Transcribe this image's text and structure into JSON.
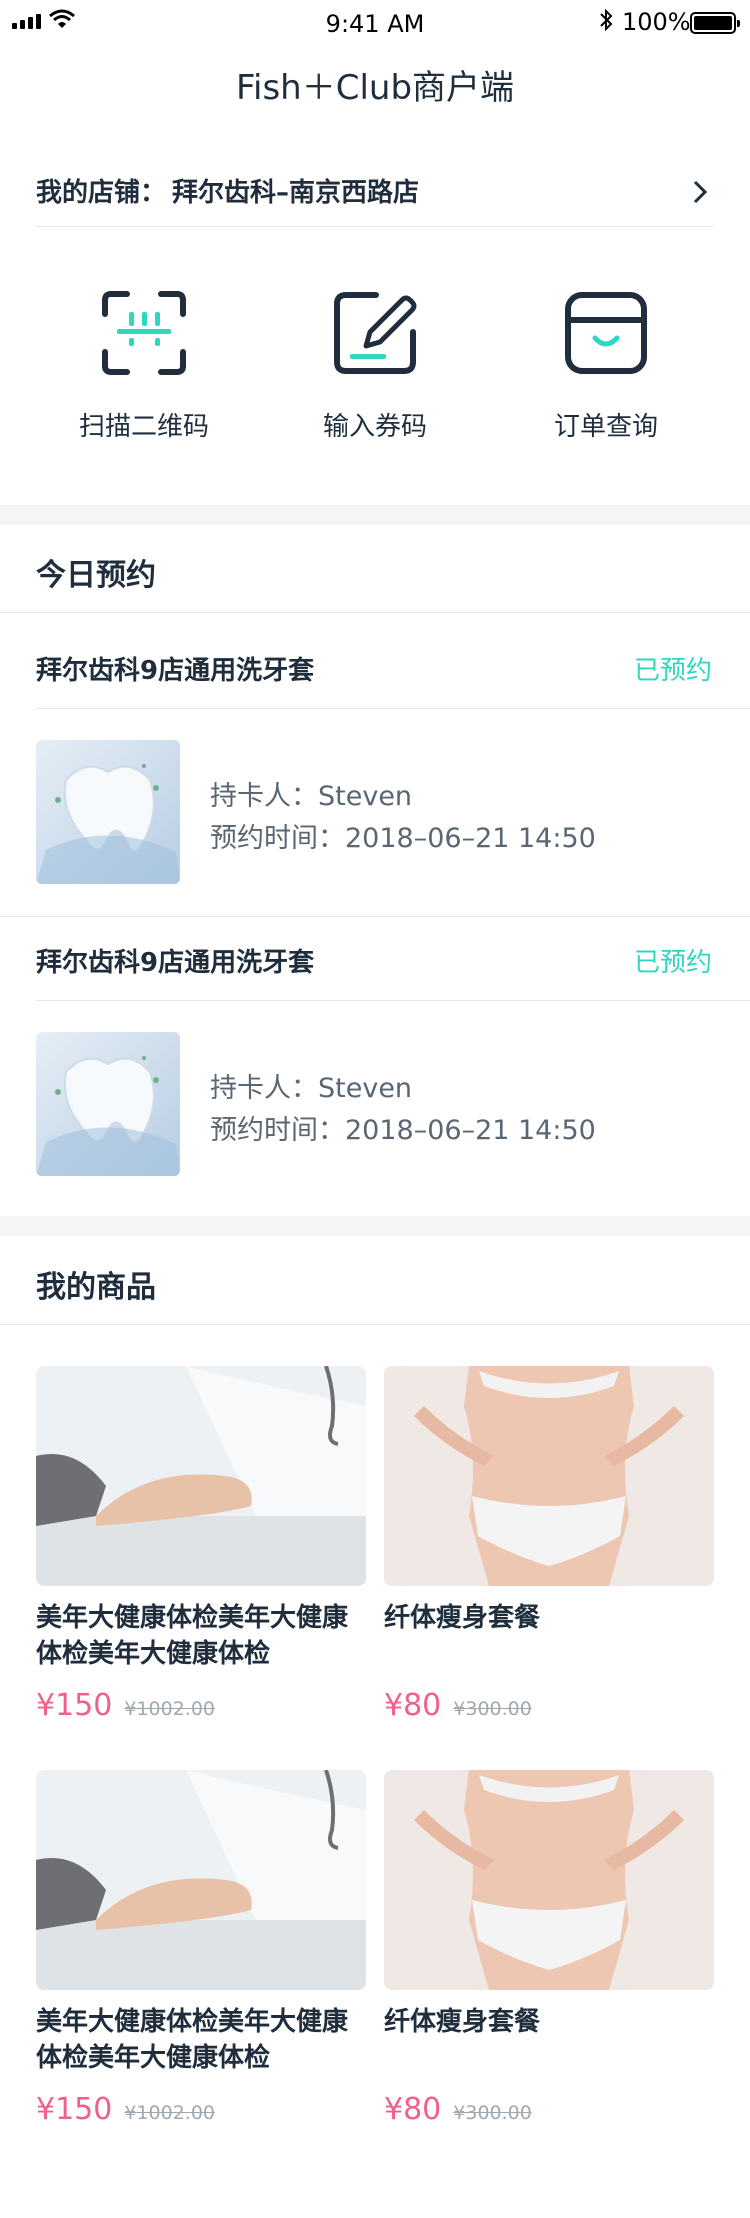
{
  "status_bar": {
    "time": "9:41 AM",
    "battery": "100%"
  },
  "header": {
    "title": "Fish＋Club商户端"
  },
  "store": {
    "label": "我的店铺：",
    "name": "拜尔齿科–南京西路店"
  },
  "quick_actions": [
    {
      "label": "扫描二维码",
      "icon": "scan-qr-icon"
    },
    {
      "label": "输入券码",
      "icon": "edit-icon"
    },
    {
      "label": "订单查询",
      "icon": "order-box-icon"
    }
  ],
  "appointments": {
    "title": "今日预约",
    "items": [
      {
        "name": "拜尔齿科9店通用洗牙套",
        "status": "已预约",
        "holder": "持卡人：Steven",
        "time": "预约时间：2018–06–21 14:50"
      },
      {
        "name": "拜尔齿科9店通用洗牙套",
        "status": "已预约",
        "holder": "持卡人：Steven",
        "time": "预约时间：2018–06–21 14:50"
      }
    ]
  },
  "products": {
    "title": "我的商品",
    "items": [
      {
        "name": "美年大健康体检美年大健康体检美年大健康体检",
        "price": "¥150",
        "old_price": "¥1002.00"
      },
      {
        "name": "纤体瘦身套餐",
        "price": "¥80",
        "old_price": "¥300.00"
      },
      {
        "name": "美年大健康体检美年大健康体检美年大健康体检",
        "price": "¥150",
        "old_price": "¥1002.00"
      },
      {
        "name": "纤体瘦身套餐",
        "price": "¥80",
        "old_price": "¥300.00"
      }
    ]
  },
  "colors": {
    "accent": "#2fd6c0",
    "price": "#f0608a",
    "text": "#1f2d3d"
  }
}
